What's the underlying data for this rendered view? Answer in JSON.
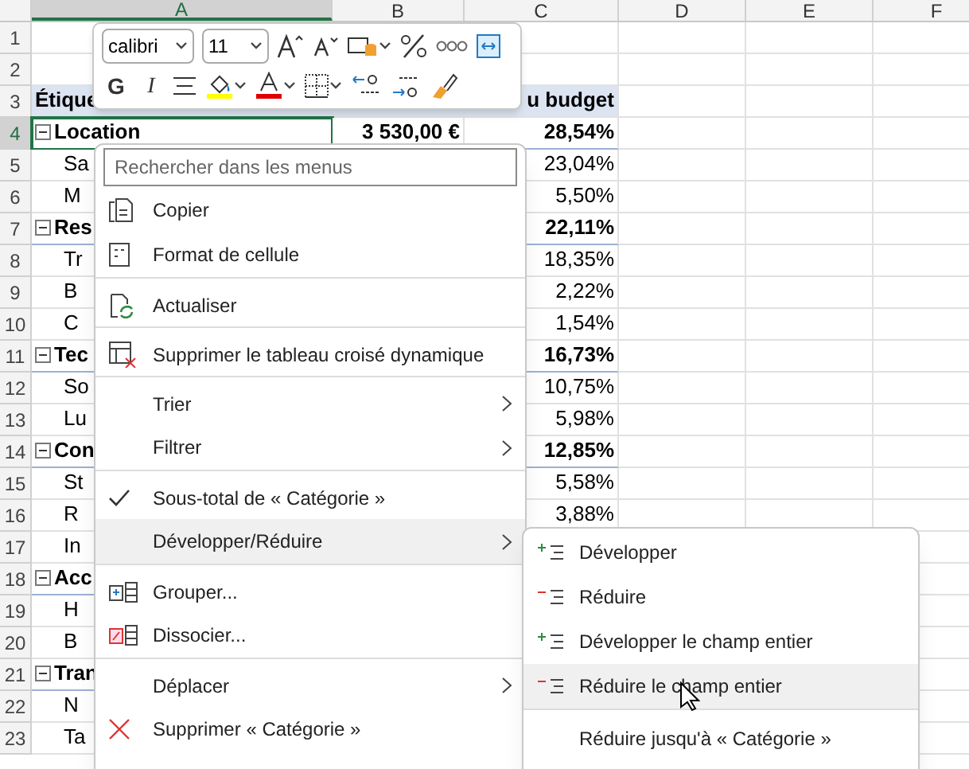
{
  "columns": [
    {
      "label": "A",
      "selected": true
    },
    {
      "label": "B",
      "selected": false
    },
    {
      "label": "C",
      "selected": false
    },
    {
      "label": "D",
      "selected": false
    },
    {
      "label": "E",
      "selected": false
    },
    {
      "label": "F",
      "selected": false
    }
  ],
  "rows": [
    {
      "number": "1",
      "selected": false,
      "kind": "blank",
      "a": "",
      "b": "",
      "c": ""
    },
    {
      "number": "2",
      "selected": false,
      "kind": "blank",
      "a": "",
      "b": "",
      "c": ""
    },
    {
      "number": "3",
      "selected": false,
      "kind": "header",
      "a": "Étique",
      "b": "",
      "c": "u budget"
    },
    {
      "number": "4",
      "selected": true,
      "kind": "group",
      "a": "Location",
      "b": "3 530,00 €",
      "c": "28,54%"
    },
    {
      "number": "5",
      "selected": false,
      "kind": "item",
      "a": "Sa",
      "b": "",
      "c": "23,04%"
    },
    {
      "number": "6",
      "selected": false,
      "kind": "item",
      "a": "M",
      "b": "",
      "c": "5,50%"
    },
    {
      "number": "7",
      "selected": false,
      "kind": "group",
      "a": "Res",
      "b": "",
      "c": "22,11%"
    },
    {
      "number": "8",
      "selected": false,
      "kind": "item",
      "a": "Tr",
      "b": "",
      "c": "18,35%"
    },
    {
      "number": "9",
      "selected": false,
      "kind": "item",
      "a": "B",
      "b": "",
      "c": "2,22%"
    },
    {
      "number": "10",
      "selected": false,
      "kind": "item",
      "a": "C",
      "b": "",
      "c": "1,54%"
    },
    {
      "number": "11",
      "selected": false,
      "kind": "group",
      "a": "Tec",
      "b": "",
      "c": "16,73%"
    },
    {
      "number": "12",
      "selected": false,
      "kind": "item",
      "a": "So",
      "b": "",
      "c": "10,75%"
    },
    {
      "number": "13",
      "selected": false,
      "kind": "item",
      "a": "Lu",
      "b": "",
      "c": "5,98%"
    },
    {
      "number": "14",
      "selected": false,
      "kind": "group",
      "a": "Con",
      "b": "",
      "c": "12,85%"
    },
    {
      "number": "15",
      "selected": false,
      "kind": "item",
      "a": "St",
      "b": "",
      "c": "5,58%"
    },
    {
      "number": "16",
      "selected": false,
      "kind": "item",
      "a": "R",
      "b": "",
      "c": "3,88%"
    },
    {
      "number": "17",
      "selected": false,
      "kind": "item",
      "a": "In",
      "b": "",
      "c": ""
    },
    {
      "number": "18",
      "selected": false,
      "kind": "group",
      "a": "Acc",
      "b": "",
      "c": ""
    },
    {
      "number": "19",
      "selected": false,
      "kind": "item",
      "a": "H",
      "b": "",
      "c": ""
    },
    {
      "number": "20",
      "selected": false,
      "kind": "item",
      "a": "B",
      "b": "",
      "c": ""
    },
    {
      "number": "21",
      "selected": false,
      "kind": "group",
      "a": "Tran",
      "b": "",
      "c": ""
    },
    {
      "number": "22",
      "selected": false,
      "kind": "item",
      "a": "N",
      "b": "",
      "c": ""
    },
    {
      "number": "23",
      "selected": false,
      "kind": "item",
      "a": "Ta",
      "b": "",
      "c": ""
    }
  ],
  "mini_toolbar": {
    "font": "calibri",
    "size": "11",
    "bold_label": "G",
    "italic_label": "I"
  },
  "context_menu": {
    "search": {
      "placeholder": "Rechercher dans les menus"
    },
    "items": [
      {
        "label": "Copier",
        "divider_before": false,
        "submenu": false,
        "checked": false,
        "selected": false
      },
      {
        "label": "Format de cellule",
        "divider_before": false,
        "submenu": false,
        "checked": false,
        "selected": false
      },
      {
        "label": "Actualiser",
        "divider_before": true,
        "submenu": false,
        "checked": false,
        "selected": false
      },
      {
        "label": "Supprimer le tableau croisé dynamique",
        "divider_before": true,
        "submenu": false,
        "checked": false,
        "selected": false
      },
      {
        "label": "Trier",
        "divider_before": true,
        "submenu": true,
        "checked": false,
        "selected": false
      },
      {
        "label": "Filtrer",
        "divider_before": false,
        "submenu": true,
        "checked": false,
        "selected": false
      },
      {
        "label": "Sous-total de « Catégorie »",
        "divider_before": true,
        "submenu": false,
        "checked": true,
        "selected": false
      },
      {
        "label": "Développer/Réduire",
        "divider_before": false,
        "submenu": true,
        "checked": false,
        "selected": true
      },
      {
        "label": "Grouper...",
        "divider_before": true,
        "submenu": false,
        "checked": false,
        "selected": false
      },
      {
        "label": "Dissocier...",
        "divider_before": false,
        "submenu": false,
        "checked": false,
        "selected": false
      },
      {
        "label": "Déplacer",
        "divider_before": true,
        "submenu": true,
        "checked": false,
        "selected": false
      },
      {
        "label": "Supprimer « Catégorie »",
        "divider_before": false,
        "submenu": false,
        "checked": false,
        "selected": false
      }
    ]
  },
  "submenu": {
    "items": [
      {
        "label": "Développer",
        "divider_before": false,
        "selected": false
      },
      {
        "label": "Réduire",
        "divider_before": false,
        "selected": false
      },
      {
        "label": "Développer le champ entier",
        "divider_before": false,
        "selected": false
      },
      {
        "label": "Réduire le champ entier",
        "divider_before": false,
        "selected": true
      },
      {
        "label": "Réduire jusqu'à « Catégorie »",
        "divider_before": true,
        "selected": false
      }
    ]
  }
}
